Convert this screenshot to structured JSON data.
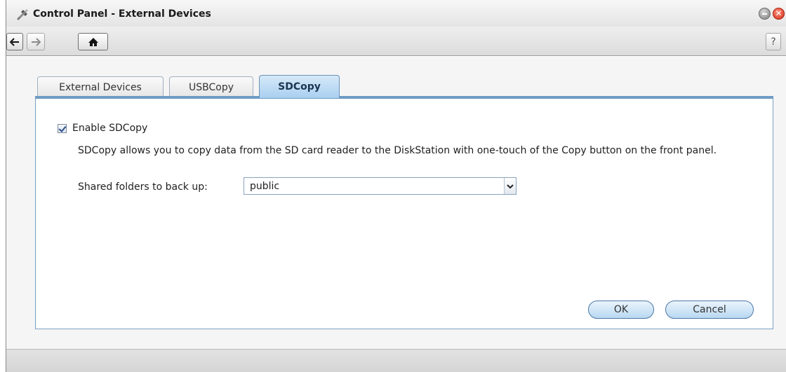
{
  "window": {
    "title": "Control Panel - External Devices",
    "close_glyph": "✕"
  },
  "toolbar": {
    "back_icon": "arrow-left-icon",
    "forward_icon": "arrow-right-icon",
    "home_icon": "home-icon",
    "help_label": "?"
  },
  "tabs": [
    {
      "label": "External Devices",
      "active": false
    },
    {
      "label": "USBCopy",
      "active": false
    },
    {
      "label": "SDCopy",
      "active": true
    }
  ],
  "sdcopy": {
    "enable_label": "Enable SDCopy",
    "enabled": true,
    "description": "SDCopy allows you to copy data from the SD card reader to the DiskStation with one-touch of the Copy button on the front panel.",
    "shared_folder_label": "Shared folders to back up:",
    "shared_folder_value": "public"
  },
  "buttons": {
    "ok": "OK",
    "cancel": "Cancel"
  },
  "colors": {
    "accent": "#6e9bc4",
    "active_tab": "#a9cff0",
    "close": "#d2301a"
  }
}
